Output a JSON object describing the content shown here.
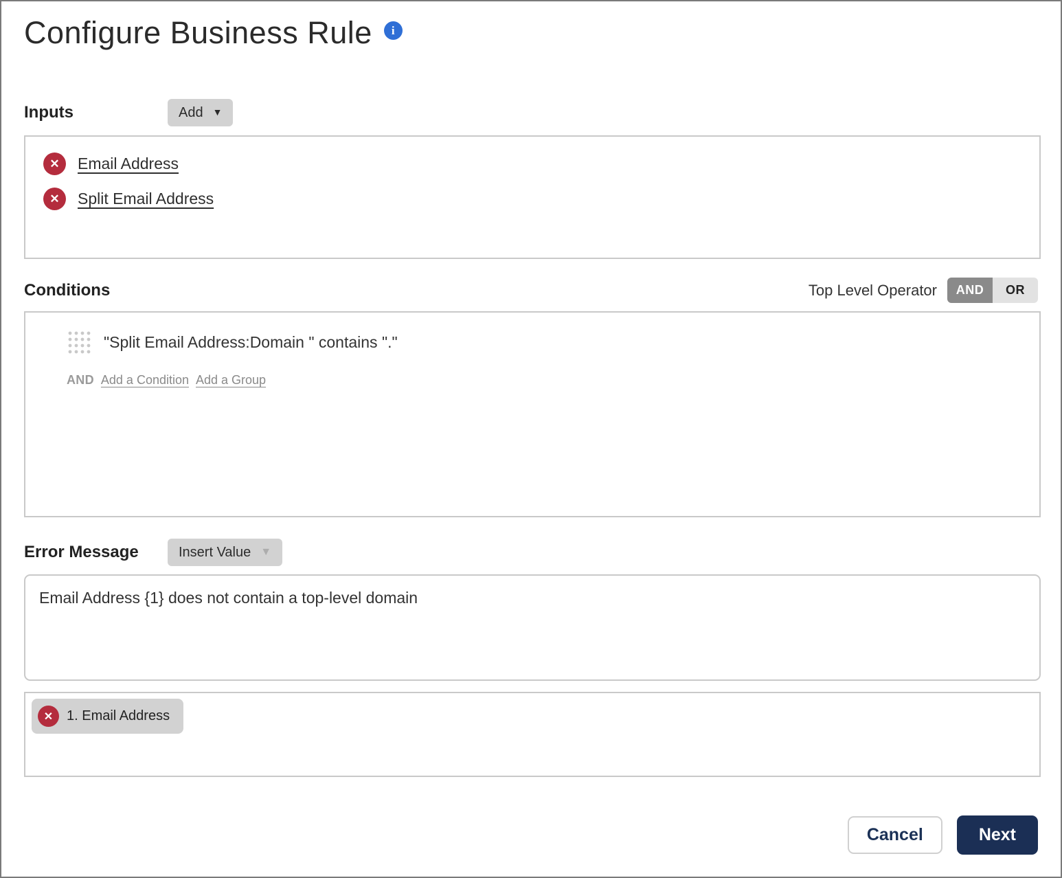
{
  "page": {
    "title": "Configure Business Rule"
  },
  "inputs": {
    "label": "Inputs",
    "add_button_label": "Add",
    "items": [
      {
        "label": "Email Address"
      },
      {
        "label": "Split Email Address"
      }
    ]
  },
  "conditions": {
    "label": "Conditions",
    "top_level_operator_label": "Top Level Operator",
    "operator_and": "AND",
    "operator_or": "OR",
    "selected_operator": "AND",
    "rows": [
      {
        "text": "\"Split Email Address:Domain \" contains \".\""
      }
    ],
    "footer": {
      "operator": "AND",
      "add_condition_label": "Add a Condition",
      "add_group_label": "Add a Group"
    }
  },
  "error_message": {
    "label": "Error Message",
    "insert_value_button_label": "Insert Value",
    "text": "Email Address {1} does not contain a top-level domain",
    "values": [
      {
        "label": "1. Email Address"
      }
    ]
  },
  "footer": {
    "cancel_label": "Cancel",
    "next_label": "Next"
  },
  "icons": {
    "info": "i",
    "delete_x": "✕",
    "caret_down": "▼"
  },
  "colors": {
    "accent_navy": "#1b2f55",
    "danger_red": "#b42c3d",
    "info_blue": "#2f6fd6",
    "toggle_active_gray": "#8a8a8a",
    "chip_gray": "#d2d2d2",
    "border_gray": "#c9c9c9"
  }
}
